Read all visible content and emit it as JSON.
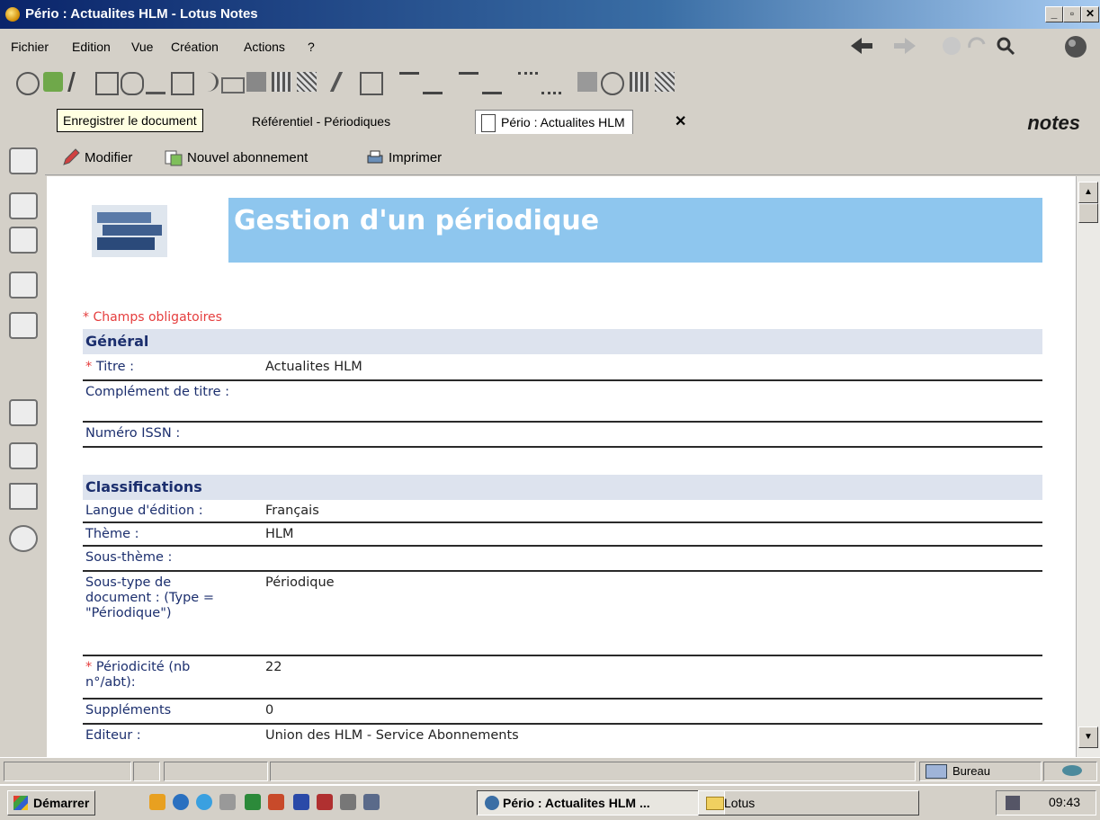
{
  "window": {
    "title": "Pério : Actualites HLM - Lotus Notes",
    "controls": [
      "_",
      "▫",
      "✕"
    ]
  },
  "menu": [
    "Fichier",
    "Edition",
    "Vue",
    "Création",
    "Actions",
    "?"
  ],
  "tooltip": "Enregistrer le document",
  "tabs": [
    {
      "label": "Référentiel - Périodiques"
    },
    {
      "label": "Pério : Actualites HLM"
    }
  ],
  "tab_close": "✕",
  "brand": "notes",
  "actions": {
    "modify": "Modifier",
    "new_subscription": "Nouvel abonnement",
    "print": "Imprimer"
  },
  "form": {
    "title": "Gestion d'un périodique",
    "required_note": "* Champs obligatoires",
    "star": "* ",
    "sections": {
      "general": "Général",
      "classifications": "Classifications"
    },
    "fields": {
      "titre": {
        "label": "Titre :",
        "value": "Actualites HLM"
      },
      "complement": {
        "label": "Complément de titre :",
        "value": ""
      },
      "issn": {
        "label": "Numéro ISSN :",
        "value": ""
      },
      "langue": {
        "label": "Langue d'édition :",
        "value": "Français"
      },
      "theme": {
        "label": "Thème :",
        "value": "HLM"
      },
      "sous_theme": {
        "label": "Sous-thème :",
        "value": ""
      },
      "sous_type": {
        "label": "Sous-type de document : (Type = \"Périodique\")",
        "value": "Périodique"
      },
      "periodicite": {
        "label": "Périodicité (nb n°/abt):",
        "value": "22"
      },
      "supplements": {
        "label": "Suppléments",
        "value": "0"
      },
      "editeur": {
        "label": "Editeur :",
        "value": "Union des HLM - Service Abonnements"
      }
    }
  },
  "status": {
    "location": "Bureau"
  },
  "taskbar": {
    "start": "Démarrer",
    "tasks": [
      "Pério : Actualites HLM ...",
      "Lotus"
    ],
    "clock": "09:43"
  },
  "colors": {
    "title_band": "#8ec6ee",
    "label": "#1c2f6e",
    "required": "#e53e3e",
    "section_bg": "#dde3ee"
  }
}
